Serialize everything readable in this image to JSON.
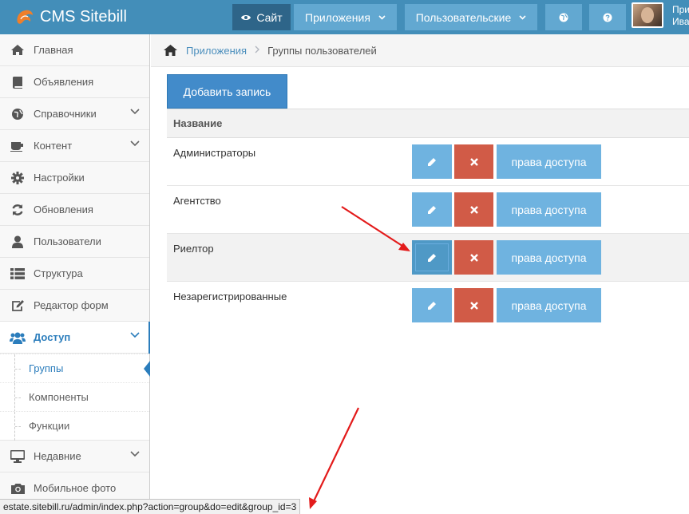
{
  "navbar": {
    "brand": "CMS Sitebill",
    "site_label": "Сайт",
    "apps_label": "Приложения",
    "user_menu_label": "Пользовательские",
    "user_greeting": "При",
    "user_name": "Ива"
  },
  "sidebar": {
    "items": [
      {
        "label": "Главная",
        "icon": "home-icon"
      },
      {
        "label": "Объявления",
        "icon": "book-icon"
      },
      {
        "label": "Справочники",
        "icon": "globe-icon",
        "has_children": true
      },
      {
        "label": "Контент",
        "icon": "coffee-icon",
        "has_children": true
      },
      {
        "label": "Настройки",
        "icon": "gear-icon"
      },
      {
        "label": "Обновления",
        "icon": "refresh-icon"
      },
      {
        "label": "Пользователи",
        "icon": "user-icon"
      },
      {
        "label": "Структура",
        "icon": "list-icon"
      },
      {
        "label": "Редактор форм",
        "icon": "edit-icon"
      },
      {
        "label": "Доступ",
        "icon": "users-icon",
        "has_children": true,
        "active": true
      },
      {
        "label": "Недавние",
        "icon": "desktop-icon",
        "has_children": true
      },
      {
        "label": "Мобильное фото",
        "icon": "camera-icon"
      }
    ],
    "submenu": [
      {
        "label": "Группы",
        "active": true
      },
      {
        "label": "Компоненты"
      },
      {
        "label": "Функции"
      }
    ]
  },
  "breadcrumbs": {
    "root": "Приложения",
    "current": "Группы пользователей"
  },
  "main": {
    "add_button": "Добавить запись",
    "table": {
      "header": "Название",
      "rows": [
        {
          "name": "Администраторы"
        },
        {
          "name": "Агентство"
        },
        {
          "name": "Риелтор",
          "highlighted": true
        },
        {
          "name": "Незарегистрированные"
        }
      ],
      "access_label": "права доступа"
    }
  },
  "statusbar": {
    "url": "estate.sitebill.ru/admin/index.php?action=group&do=edit&group_id=3"
  },
  "colors": {
    "navbar": "#438eb9",
    "primary": "#428bca",
    "edit": "#6fb3e0",
    "delete": "#d15b47",
    "active_text": "#2b7dbc",
    "annotation_arrow": "#e31b1b"
  }
}
